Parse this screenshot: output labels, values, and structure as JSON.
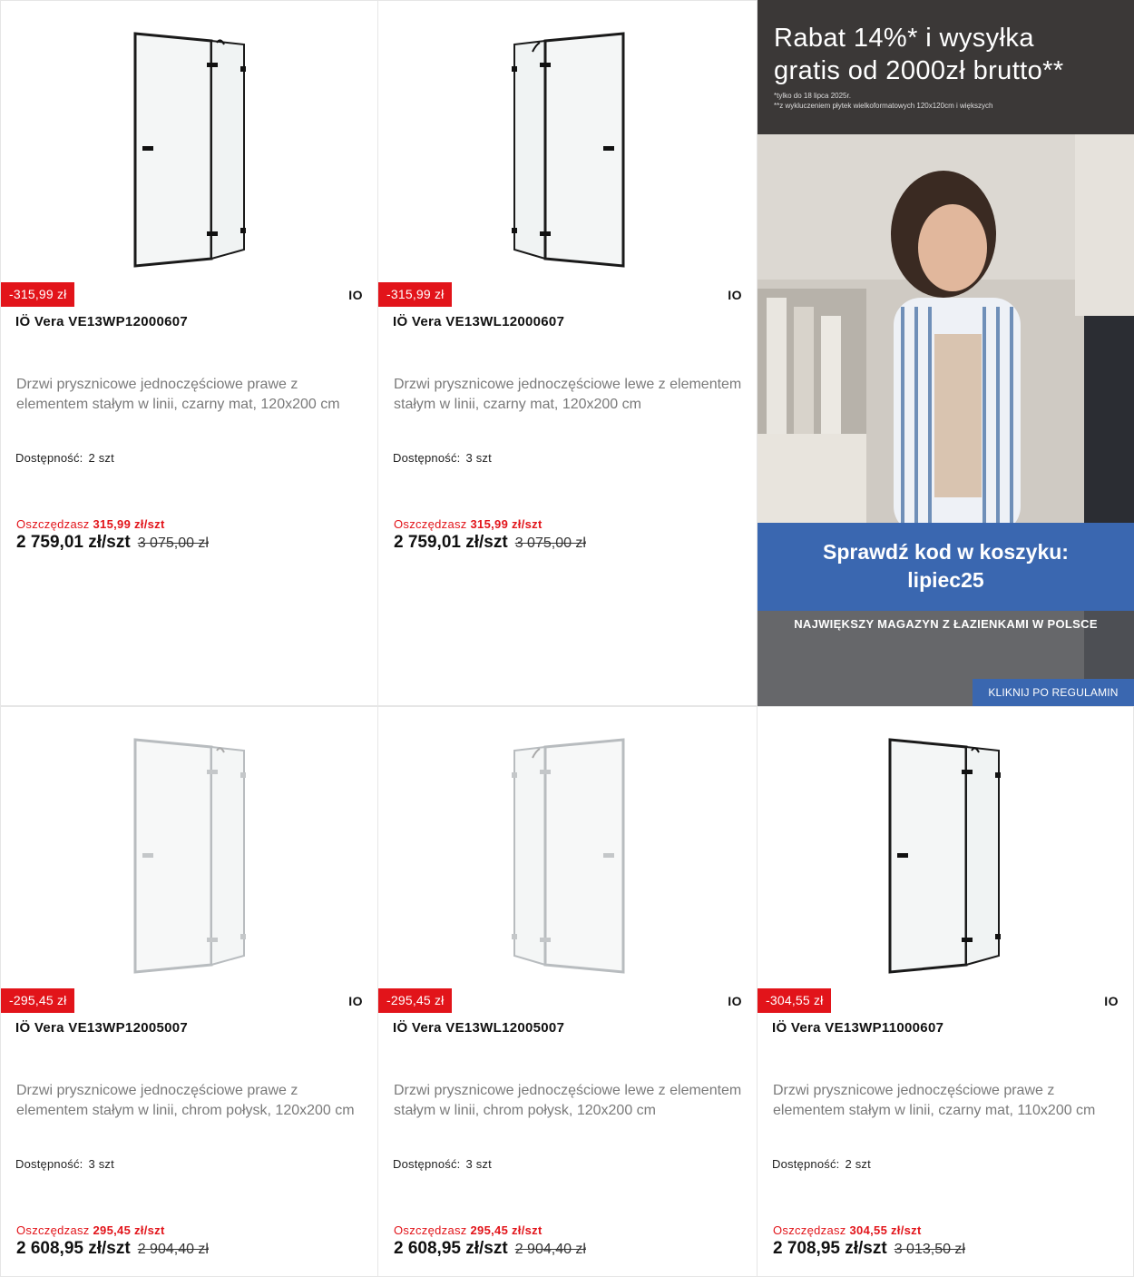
{
  "products": [
    {
      "discount": "-315,99 zł",
      "brand": "IO",
      "title": "IÖ Vera VE13WP12000607",
      "description": "Drzwi prysznicowe jednoczęściowe prawe z elementem stałym w linii, czarny mat, 120x200 cm",
      "availability_label": "Dostępność:",
      "availability_value": "2 szt",
      "save_label": "Oszczędzasz",
      "save_value": "315,99 zł/szt",
      "price": "2 759,01 zł/szt",
      "old_price": "3 075,00 zł",
      "finish": "black",
      "hinge": "right"
    },
    {
      "discount": "-315,99 zł",
      "brand": "IO",
      "title": "IÖ Vera VE13WL12000607",
      "description": "Drzwi prysznicowe jednoczęściowe lewe z elementem stałym w linii, czarny mat, 120x200 cm",
      "availability_label": "Dostępność:",
      "availability_value": "3 szt",
      "save_label": "Oszczędzasz",
      "save_value": "315,99 zł/szt",
      "price": "2 759,01 zł/szt",
      "old_price": "3 075,00 zł",
      "finish": "black",
      "hinge": "left"
    },
    {
      "discount": "-295,45 zł",
      "brand": "IO",
      "title": "IÖ Vera VE13WP12005007",
      "description": "Drzwi prysznicowe jednoczęściowe prawe z elementem stałym w linii, chrom połysk, 120x200 cm",
      "availability_label": "Dostępność:",
      "availability_value": "3 szt",
      "save_label": "Oszczędzasz",
      "save_value": "295,45 zł/szt",
      "price": "2 608,95 zł/szt",
      "old_price": "2 904,40 zł",
      "finish": "chrome",
      "hinge": "right"
    },
    {
      "discount": "-295,45 zł",
      "brand": "IO",
      "title": "IÖ Vera VE13WL12005007",
      "description": "Drzwi prysznicowe jednoczęściowe lewe z elementem stałym w linii, chrom połysk, 120x200 cm",
      "availability_label": "Dostępność:",
      "availability_value": "3 szt",
      "save_label": "Oszczędzasz",
      "save_value": "295,45 zł/szt",
      "price": "2 608,95 zł/szt",
      "old_price": "2 904,40 zł",
      "finish": "chrome",
      "hinge": "left"
    },
    {
      "discount": "-304,55 zł",
      "brand": "IO",
      "title": "IÖ Vera VE13WP11000607",
      "description": "Drzwi prysznicowe jednoczęściowe prawe z elementem stałym w linii, czarny mat, 110x200 cm",
      "availability_label": "Dostępność:",
      "availability_value": "2 szt",
      "save_label": "Oszczędzasz",
      "save_value": "304,55 zł/szt",
      "price": "2 708,95 zł/szt",
      "old_price": "3 013,50 zł",
      "finish": "black",
      "hinge": "right"
    }
  ],
  "banner": {
    "headline_1": "Rabat 14%* i wysyłka",
    "headline_2": "gratis od 2000zł brutto**",
    "fine_1": "*tylko do 18 lipca 2025r.",
    "fine_2": "**z wykluczeniem płytek wielkoformatowych 120x120cm i większych",
    "code_1": "Sprawdź kod w koszyku:",
    "code_2": "lipiec25",
    "tagline": "NAJWIĘKSZY MAGAZYN Z ŁAZIENKAMI W POLSCE",
    "cta": "KLIKNIJ PO REGULAMIN"
  },
  "colors": {
    "discount_red": "#e2141a",
    "banner_blue": "#3a67b0",
    "banner_dark": "#3b3837"
  }
}
